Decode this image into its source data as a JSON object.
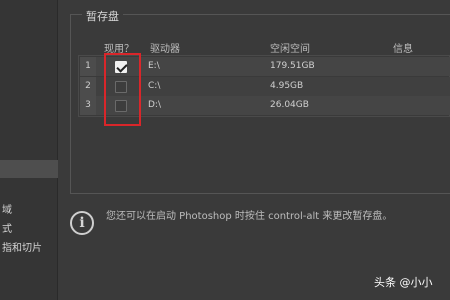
{
  "sidebar": {
    "items": [
      "域",
      "式",
      "指和切片"
    ]
  },
  "scratch_disks": {
    "title": "暂存盘",
    "headers": {
      "use": "现用？",
      "drive": "驱动器",
      "free": "空闲空间",
      "info": "信息"
    },
    "rows": [
      {
        "index": "1",
        "checked": true,
        "drive": "E:\\",
        "free": "179.51GB"
      },
      {
        "index": "2",
        "checked": false,
        "drive": "C:\\",
        "free": "4.95GB"
      },
      {
        "index": "3",
        "checked": false,
        "drive": "D:\\",
        "free": "26.04GB"
      }
    ]
  },
  "info": {
    "icon": "info-icon",
    "text": "您还可以在启动 Photoshop 时按住 control-alt 来更改暂存盘。"
  },
  "watermark": "头条 @小小"
}
